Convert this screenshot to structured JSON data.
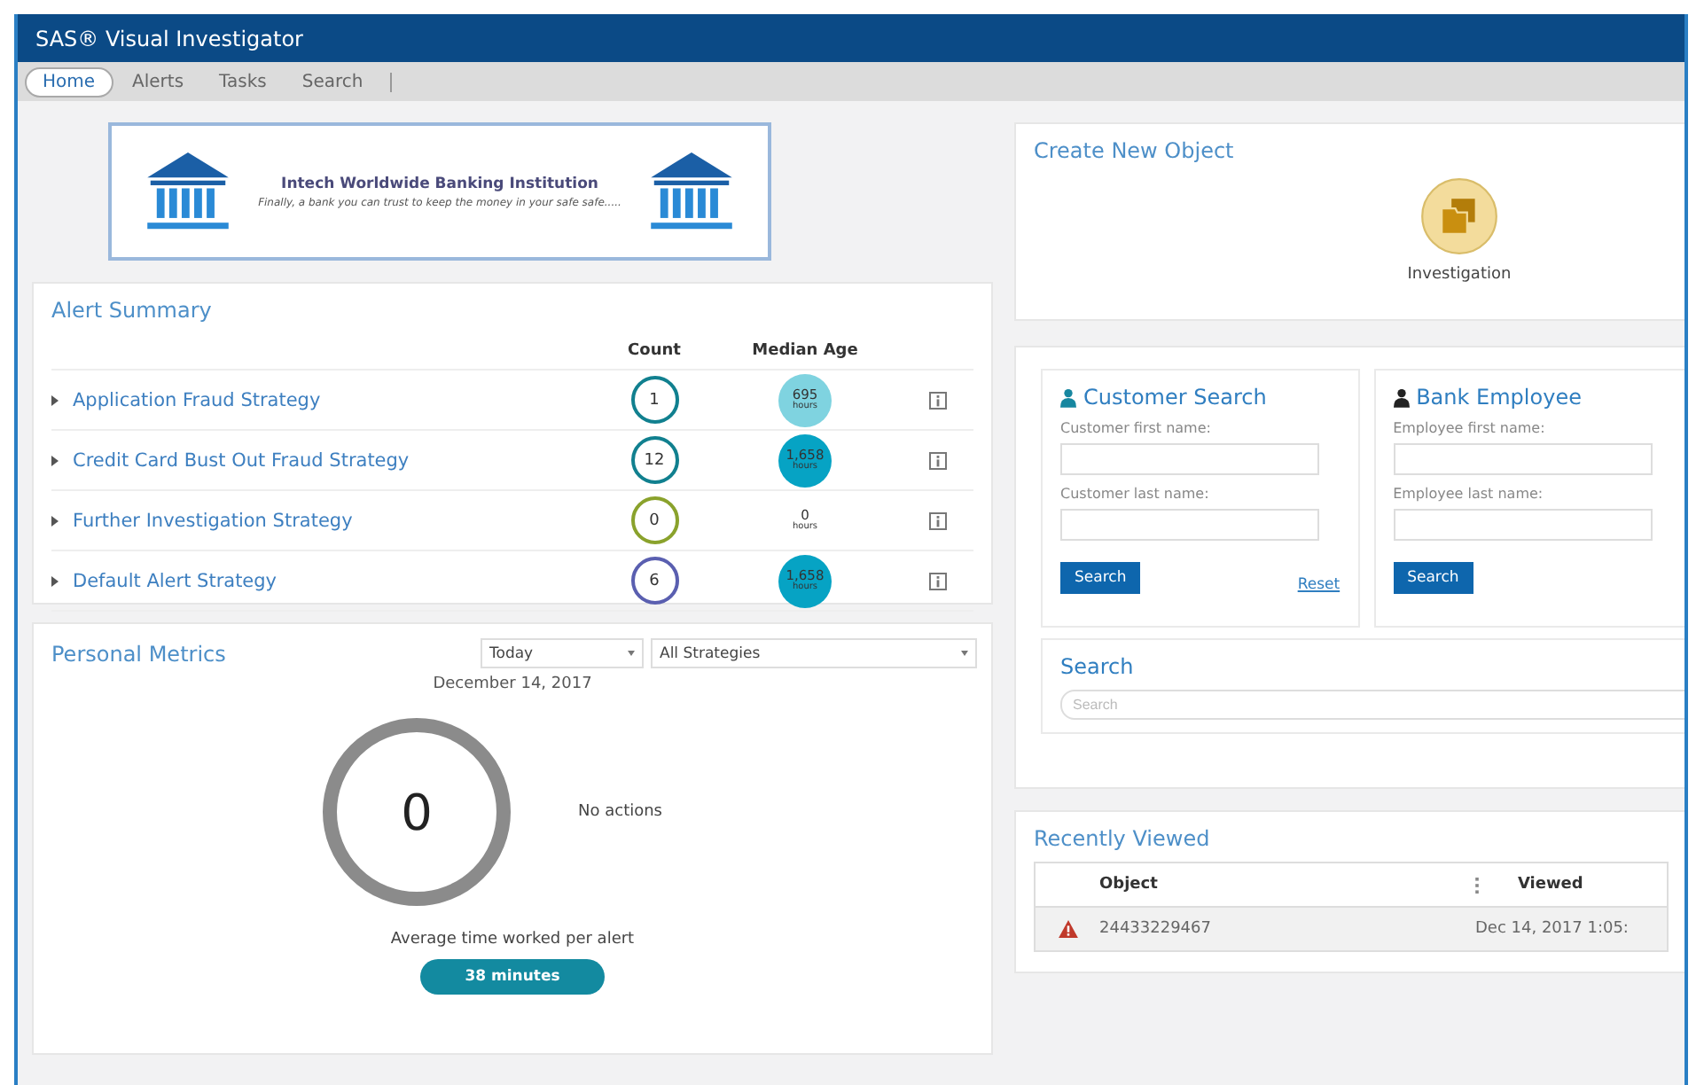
{
  "window": {
    "title": "SAS® Visual Investigator"
  },
  "tabs": [
    {
      "label": "Home",
      "selected": true
    },
    {
      "label": "Alerts",
      "selected": false
    },
    {
      "label": "Tasks",
      "selected": false
    },
    {
      "label": "Search",
      "selected": false
    }
  ],
  "banner": {
    "title": "Intech Worldwide Banking Institution",
    "tagline": "Finally, a bank you can trust to keep the money in your safe safe....."
  },
  "alert_summary": {
    "title": "Alert Summary",
    "columns": [
      "Count",
      "Median Age"
    ],
    "rows": [
      {
        "name": "Application Fraud Strategy",
        "count": {
          "value": "1",
          "color": "#11808f"
        },
        "median_age": {
          "value": "695",
          "unit": "hours",
          "color": "#7fd3e0"
        }
      },
      {
        "name": "Credit Card Bust Out Fraud Strategy",
        "count": {
          "value": "12",
          "color": "#11808f"
        },
        "median_age": {
          "value": "1,658",
          "unit": "hours",
          "color": "#06a3c4"
        }
      },
      {
        "name": "Further Investigation Strategy",
        "count": {
          "value": "0",
          "color": "#8aa22c"
        },
        "median_age": {
          "value": "0",
          "unit": "hours"
        }
      },
      {
        "name": "Default Alert Strategy",
        "count": {
          "value": "6",
          "color": "#5a5fb0"
        },
        "median_age": {
          "value": "1,658",
          "unit": "hours",
          "color": "#06a3c4"
        }
      }
    ]
  },
  "personal_metrics": {
    "title": "Personal Metrics",
    "period": "Today",
    "strategy": "All Strategies",
    "date": "December 14, 2017",
    "total": "0",
    "legend": "No actions",
    "average_label": "Average time worked per alert",
    "average_value": "38 minutes"
  },
  "create_new_object": {
    "title": "Create New Object",
    "items": [
      {
        "label": "Investigation"
      }
    ]
  },
  "customer_search": {
    "title": "Customer Search",
    "fields": [
      {
        "label": "Customer first name:"
      },
      {
        "label": "Customer last name:"
      }
    ],
    "button": "Search",
    "reset": "Reset"
  },
  "employee_search": {
    "title": "Bank Employee",
    "fields": [
      {
        "label": "Employee first name:"
      },
      {
        "label": "Employee last name:"
      }
    ],
    "button": "Search"
  },
  "search": {
    "title": "Search",
    "placeholder": "Search"
  },
  "recently_viewed": {
    "title": "Recently Viewed",
    "columns": [
      "Object",
      "Viewed"
    ],
    "rows": [
      {
        "object": "24433229467",
        "viewed": "Dec 14, 2017 1:05:"
      }
    ]
  }
}
